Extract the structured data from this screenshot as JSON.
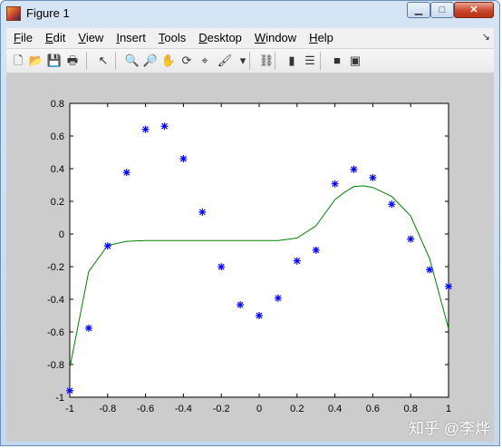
{
  "window": {
    "title": "Figure 1",
    "min_symbol": "▁",
    "max_symbol": "□",
    "close_symbol": "✕"
  },
  "menu": [
    {
      "label": "File",
      "acc": "F",
      "rest": "ile"
    },
    {
      "label": "Edit",
      "acc": "E",
      "rest": "dit"
    },
    {
      "label": "View",
      "acc": "V",
      "rest": "iew"
    },
    {
      "label": "Insert",
      "acc": "I",
      "rest": "nsert"
    },
    {
      "label": "Tools",
      "acc": "T",
      "rest": "ools"
    },
    {
      "label": "Desktop",
      "acc": "D",
      "rest": "esktop"
    },
    {
      "label": "Window",
      "acc": "W",
      "rest": "indow"
    },
    {
      "label": "Help",
      "acc": "H",
      "rest": "elp"
    }
  ],
  "menu_overflow": "↘",
  "toolbar": [
    {
      "name": "new-figure-icon",
      "glyph": "🗋"
    },
    {
      "name": "open-file-icon",
      "glyph": "📂"
    },
    {
      "name": "save-icon",
      "glyph": "💾"
    },
    {
      "name": "print-icon",
      "glyph": "🖶"
    },
    {
      "name": "edit-plot-icon",
      "glyph": "↖"
    },
    {
      "name": "zoom-in-icon",
      "glyph": "🔍"
    },
    {
      "name": "zoom-out-icon",
      "glyph": "🔎"
    },
    {
      "name": "pan-icon",
      "glyph": "✋"
    },
    {
      "name": "rotate-3d-icon",
      "glyph": "⟳"
    },
    {
      "name": "data-cursor-icon",
      "glyph": "⌖"
    },
    {
      "name": "brush-icon",
      "glyph": "🖌"
    },
    {
      "name": "brush-dropdown-icon",
      "glyph": "▾"
    },
    {
      "name": "link-plot-icon",
      "glyph": "⛓"
    },
    {
      "name": "colorbar-icon",
      "glyph": "▮"
    },
    {
      "name": "legend-icon",
      "glyph": "☰"
    },
    {
      "name": "hide-plot-tools-icon",
      "glyph": "■"
    },
    {
      "name": "show-plot-tools-icon",
      "glyph": "▣"
    }
  ],
  "watermark": "知乎 @李烨",
  "chart_data": {
    "type": "scatter",
    "xlim": [
      -1,
      1
    ],
    "ylim": [
      -1,
      0.8
    ],
    "xticks": [
      "-1",
      "-0.8",
      "-0.6",
      "-0.4",
      "-0.2",
      "0",
      "0.2",
      "0.4",
      "0.6",
      "0.8",
      "1"
    ],
    "yticks": [
      "-1",
      "-0.8",
      "-0.6",
      "-0.4",
      "-0.2",
      "0",
      "0.2",
      "0.4",
      "0.6",
      "0.8"
    ],
    "xtick_values": [
      -1,
      -0.8,
      -0.6,
      -0.4,
      -0.2,
      0,
      0.2,
      0.4,
      0.6,
      0.8,
      1
    ],
    "ytick_values": [
      -1,
      -0.8,
      -0.6,
      -0.4,
      -0.2,
      0,
      0.2,
      0.4,
      0.6,
      0.8
    ],
    "series": [
      {
        "type": "scatter",
        "marker": "*",
        "color": "#0000ff",
        "x": [
          -1,
          -0.9,
          -0.8,
          -0.7,
          -0.6,
          -0.5,
          -0.4,
          -0.3,
          -0.2,
          -0.1,
          0,
          0.1,
          0.2,
          0.3,
          0.4,
          0.5,
          0.6,
          0.7,
          0.8,
          0.9,
          1
        ],
        "y": [
          -0.96,
          -0.577,
          -0.073,
          0.377,
          0.641,
          0.66,
          0.461,
          0.134,
          -0.201,
          -0.434,
          -0.5,
          -0.393,
          -0.165,
          -0.099,
          0.307,
          0.396,
          0.345,
          0.182,
          -0.031,
          -0.219,
          -0.321
        ]
      },
      {
        "type": "line",
        "color": "#008000",
        "x": [
          -1,
          -0.9,
          -0.8,
          -0.7,
          -0.6,
          -0.5,
          -0.4,
          -0.3,
          -0.2,
          -0.1,
          0,
          0.1,
          0.2,
          0.3,
          0.4,
          0.45,
          0.5,
          0.55,
          0.6,
          0.7,
          0.8,
          0.9,
          1
        ],
        "y": [
          -0.82,
          -0.23,
          -0.07,
          -0.045,
          -0.04,
          -0.04,
          -0.04,
          -0.04,
          -0.04,
          -0.04,
          -0.04,
          -0.04,
          -0.025,
          0.05,
          0.21,
          0.255,
          0.29,
          0.295,
          0.285,
          0.23,
          0.11,
          -0.15,
          -0.58
        ]
      }
    ]
  }
}
